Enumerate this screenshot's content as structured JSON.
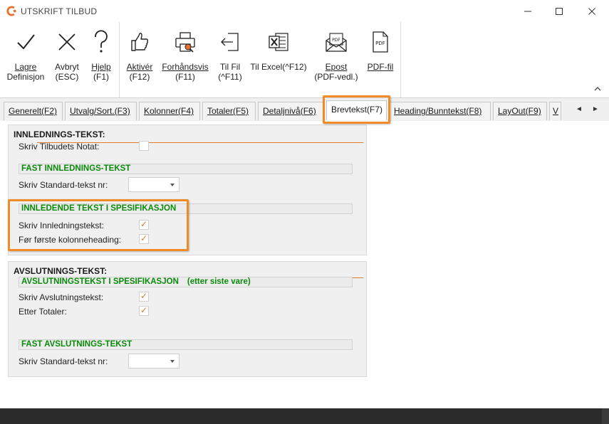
{
  "window": {
    "title": "UTSKRIFT TILBUD",
    "accent_color": "#f08c28"
  },
  "ribbon": {
    "buttons": [
      {
        "id": "lagre",
        "line1": "Lagre",
        "line2": "Definisjon",
        "icon": "checkmark-icon"
      },
      {
        "id": "avbryt",
        "line1": "Avbryt",
        "line2": "(ESC)",
        "icon": "x-icon"
      },
      {
        "id": "hjelp",
        "line1": "Hjelp",
        "line2": "(F1)",
        "icon": "question-icon"
      },
      {
        "id": "aktiver",
        "line1": "Aktivér",
        "line2": "(F12)",
        "icon": "thumbs-up-icon"
      },
      {
        "id": "forhandsvis",
        "line1": "Forhåndsvis",
        "line2": "(F11)",
        "icon": "printer-preview-icon"
      },
      {
        "id": "tilfil",
        "line1": "Til Fil",
        "line2": "(^F11)",
        "icon": "export-file-icon"
      },
      {
        "id": "tilexcel",
        "line1": "Til Excel(^F12)",
        "line2": "",
        "icon": "excel-icon"
      },
      {
        "id": "epost",
        "line1": "Epost",
        "line2": "(PDF-vedl.)",
        "icon": "pdf-email-icon"
      },
      {
        "id": "pdffil",
        "line1": "PDF-fil",
        "line2": "",
        "icon": "pdf-file-icon"
      }
    ]
  },
  "tabs": [
    {
      "label": "Generelt(F2)"
    },
    {
      "label": "Utvalg/Sort.(F3)"
    },
    {
      "label": "Kolonner(F4)"
    },
    {
      "label": "Totaler(F5)"
    },
    {
      "label": "Detaljnivå(F6)"
    },
    {
      "label": "Brevtekst(F7)",
      "active": true
    },
    {
      "label": "Heading/Bunntekst(F8)"
    },
    {
      "label": "LayOut(F9)"
    },
    {
      "label": "V"
    }
  ],
  "innledning": {
    "title": "INNLEDNINGS-TEKST:",
    "notat_label": "Skriv  Tilbudets Notat:",
    "fast_head": "FAST  INNLEDNINGS-TEKST",
    "std_label": "Skriv  Standard-tekst nr:",
    "spes_head": "INNLEDENDE  TEKST  I  SPESIFIKASJON",
    "skriv_label": "Skriv Innledningstekst:",
    "for_label": "Før første kolonneheading:"
  },
  "avslutning": {
    "title": "AVSLUTNINGS-TEKST:",
    "spes_head": "AVSLUTNINGSTEKST  I  SPESIFIKASJON",
    "spes_extra": "(etter siste vare)",
    "skriv_label": "Skriv  Avslutningstekst:",
    "etter_label": "Etter  Totaler:",
    "fast_head": "FAST  AVSLUTNINGS-TEKST",
    "std_label": "Skriv  Standard-tekst nr:"
  },
  "checkmark": "✓"
}
